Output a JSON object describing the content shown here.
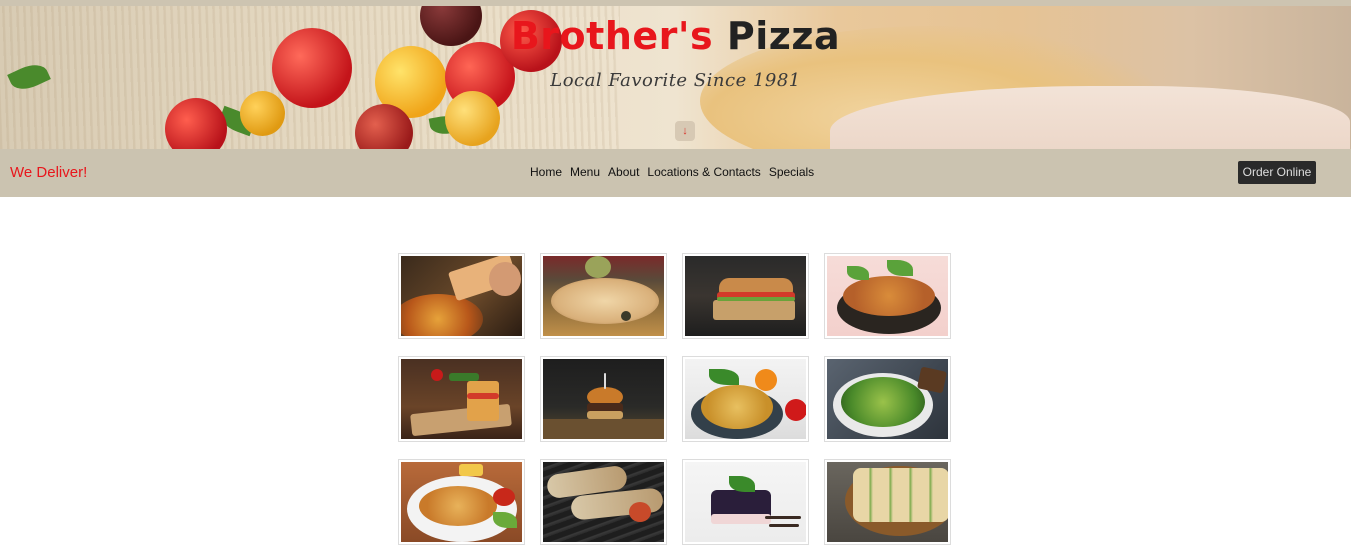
{
  "hero": {
    "title_brand": "Brother's",
    "title_rest": "Pizza",
    "tagline": "Local Favorite Since 1981",
    "scroll_icon": "arrow-down-icon"
  },
  "navbar": {
    "deliver_text": "We Deliver!",
    "links": [
      "Home",
      "Menu",
      "About",
      "Locations & Contacts",
      "Specials"
    ],
    "order_button": "Order Online"
  },
  "gallery": {
    "items": [
      {
        "name": "pizza-slice-photo"
      },
      {
        "name": "calzone-photo"
      },
      {
        "name": "sub-sandwich-photo"
      },
      {
        "name": "fried-chicken-basket-photo"
      },
      {
        "name": "club-sandwich-photo"
      },
      {
        "name": "burger-photo"
      },
      {
        "name": "spaghetti-photo"
      },
      {
        "name": "salad-bowl-photo"
      },
      {
        "name": "schnitzel-photo"
      },
      {
        "name": "grilled-chicken-photo"
      },
      {
        "name": "cheesecake-photo"
      },
      {
        "name": "sandwich-platter-photo"
      }
    ]
  },
  "colors": {
    "brand_red": "#e8161c",
    "nav_bg": "#cbc3b0",
    "button_bg": "#2a2a2a"
  }
}
